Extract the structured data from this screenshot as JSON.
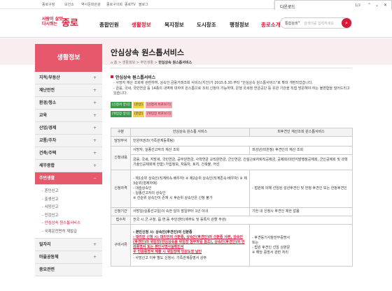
{
  "topbar": {
    "links": [
      "종로구청",
      "보건소",
      "역사문화관광",
      "종로구의회",
      "종로TV",
      "블로그"
    ],
    "find": {
      "term": "다운로드",
      "count": "1/2"
    }
  },
  "header": {
    "logo_slogan": "사람이 살맛 다시뛰는",
    "logo_name": "종로",
    "nav": [
      "종합민원",
      "생활정보",
      "복지정보",
      "도시창조",
      "행정정보",
      "종로소개"
    ],
    "search": {
      "scope": "통합검색",
      "placeholder": "검색어를 입력하세요",
      "button_icon": "search-icon"
    }
  },
  "sidebar": {
    "title": "생활정보",
    "items": [
      {
        "label": "지적/부동산",
        "icon": "+"
      },
      {
        "label": "재난안전",
        "icon": "+"
      },
      {
        "label": "환경/청소",
        "icon": "+"
      },
      {
        "label": "교육",
        "icon": "+"
      },
      {
        "label": "산업/경제",
        "icon": "+"
      },
      {
        "label": "교통/주차",
        "icon": "+"
      },
      {
        "label": "건축/주택",
        "icon": "+"
      },
      {
        "label": "세무종합",
        "icon": "+"
      },
      {
        "label": "주민생활",
        "icon": "−"
      }
    ],
    "sub": [
      "- 혼인신고",
      "- 출생신고",
      "- 사망신고",
      "- 인감신고",
      "- 안심상속 원스톱서비스",
      "- 국제운전면허 재발급"
    ],
    "current_sub_index": 4,
    "items_after": [
      {
        "label": "일자리",
        "icon": "+"
      },
      {
        "label": "마을공동체",
        "icon": "+"
      },
      {
        "label": "중요관련",
        "icon": ""
      }
    ]
  },
  "content": {
    "title": "안심상속 원스톱서비스",
    "breadcrumb": [
      "홈",
      "생활정보",
      "주민생활",
      "안심상속 원스톱서비스"
    ],
    "section_title": "안심상속 원스톱서비스",
    "desc": [
      "- 사망자 재산 조회에 관련하여, 상속인 금융거래조회 서비스(지건)가 2015.6.30.부터 \"안심상속 원스톱서비스\"로 확대 개편되었습니다.",
      "- 금융, 국세, 국민연금 등 14종의 내역에 대하여 원스톱으로 조회 신청이 가능하며, 은행 국세청 연금공단 등 유관 기관을 직접 방문해야 하는 불편함을 덜어드리고 있습니다."
    ],
    "tags_row1": [
      "[신청서 양식]",
      "[한글]",
      "[신청서 비포보기]"
    ],
    "tags_row2": [
      "[위임장 양식]",
      "[한글]",
      "[위임장 비포보기]"
    ],
    "table": {
      "headers": [
        "구분",
        "안심상속 원스톱 서비스",
        "피후견인 재산조회 원스톱서비스"
      ],
      "rows": [
        {
          "label": "담당부서",
          "merged": "민원여권과(가족관계등록팀)"
        },
        {
          "label": "신청내용",
          "a": "사망자, 실종선고자의 재산 조회",
          "b": "피성년(피한정) 후견인의 재산 조회",
          "merged_note": "금융, 국세, 지방세, 국민연금, 공무원연금, 사학연금 교직원연금, 군인연금, 건설근로자퇴직공제금, 공제회(대한지방행정공제회, 군인공제회 및 과학기술인공제회에 한함) 가입정보, 자동차, 토지, 건축물, 어선"
        },
        {
          "label": "신청자격",
          "a_lines": [
            "- 제1순위 상속인(직계비속·배우자) ※ 제2순위 상속인(직계존속·배우자) ※ 제3순위(형제자매)",
            "- 대습상속인",
            "- 실종선고자의 상속인",
            "※ 선순위 상속인이 존재 시 후순위 상속인은 신청 불가"
          ],
          "b": "- 법원에 의해 선임된 성년후견인 및 한정 후견인 또는 한정후견인"
        },
        {
          "label": "신청기간",
          "a": "사망일(실종선고일)이 속한 달의 말일부터 1년 이내",
          "b": "기한 내 신청시 후견인 제한 없음"
        },
        {
          "label": "접수처",
          "merged": "전국 시.군.구청, 읍.면.동 주민센터(제주도 및 동특지 관할 주관)"
        },
        {
          "label": "구비서류",
          "a_lines": [
            "- 본인신청 시: 상속인(후견인)의 신분증",
            "- 대리인 신청 시: 대리인의 신분증, 상속인(후견인)의 신분증 사본, 상속인(후견인)의 위임장(안심상속용 위임장 첨부파일 참조), 상속인(후견인)의 인감증명서 또는 본인서명사실확인서",
            "※ 인감증명서 제출 시 위임장에 인감도장 날인"
          ],
          "b_lines": [
            "- 후견등기사항전부증명서",
            "또는",
            "- 법원 후견인 선임 심판문",
            "※ 해당 증명서 관련 처리"
          ],
          "a2": "- 사망신고 이후 별도 신청시: 가족관계증명서 상부"
        }
      ]
    }
  }
}
